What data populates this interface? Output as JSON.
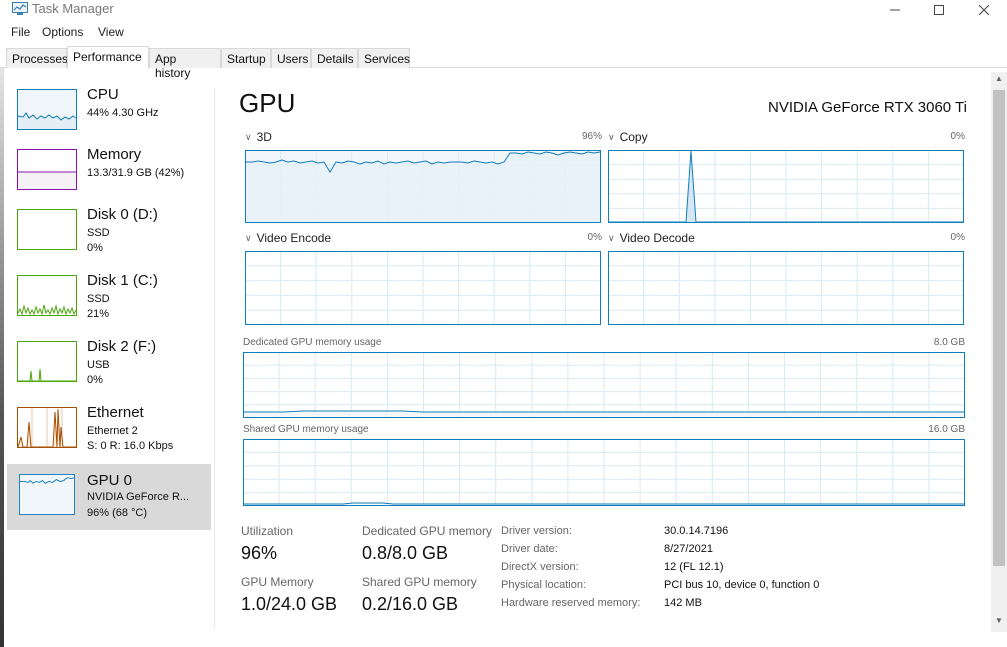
{
  "window": {
    "title": "Task Manager"
  },
  "menu": [
    "File",
    "Options",
    "View"
  ],
  "tabs": [
    {
      "label": "Processes"
    },
    {
      "label": "Performance"
    },
    {
      "label": "App history"
    },
    {
      "label": "Startup"
    },
    {
      "label": "Users"
    },
    {
      "label": "Details"
    },
    {
      "label": "Services"
    }
  ],
  "sidebar": [
    {
      "title": "CPU",
      "lines": [
        "44%  4.30 GHz"
      ],
      "color": "#117dbb",
      "fill": "#f1f6fa"
    },
    {
      "title": "Memory",
      "lines": [
        "13.3/31.9 GB (42%)"
      ],
      "color": "#8b12ae",
      "fill": "#f4f2f4"
    },
    {
      "title": "Disk 0 (D:)",
      "lines": [
        "SSD",
        "0%"
      ],
      "color": "#4da60c",
      "fill": "#ffffff"
    },
    {
      "title": "Disk 1 (C:)",
      "lines": [
        "SSD",
        "21%"
      ],
      "color": "#4da60c",
      "fill": "#ffffff"
    },
    {
      "title": "Disk 2 (F:)",
      "lines": [
        "USB",
        "0%"
      ],
      "color": "#4da60c",
      "fill": "#ffffff"
    },
    {
      "title": "Ethernet",
      "lines": [
        "Ethernet 2",
        "S: 0  R: 16.0 Kbps"
      ],
      "color": "#a74f01",
      "fill": "#ffffff"
    },
    {
      "title": "GPU 0",
      "lines": [
        "NVIDIA GeForce R...",
        "96%  (68 °C)"
      ],
      "color": "#117dbb",
      "fill": "#f1f6fa"
    }
  ],
  "main": {
    "heading": "GPU",
    "model": "NVIDIA GeForce RTX 3060 Ti",
    "engines": [
      {
        "label": "3D",
        "max": "96%"
      },
      {
        "label": "Copy",
        "max": "0%"
      },
      {
        "label": "Video Encode",
        "max": "0%"
      },
      {
        "label": "Video Decode",
        "max": "0%"
      }
    ],
    "dedicated": {
      "label": "Dedicated GPU memory usage",
      "max": "8.0 GB"
    },
    "shared": {
      "label": "Shared GPU memory usage",
      "max": "16.0 GB"
    },
    "stats": {
      "utilization": {
        "label": "Utilization",
        "value": "96%"
      },
      "dedicated_mem": {
        "label": "Dedicated GPU memory",
        "value": "0.8/8.0 GB"
      },
      "gpu_mem": {
        "label": "GPU Memory",
        "value": "1.0/24.0 GB"
      },
      "shared_mem": {
        "label": "Shared GPU memory",
        "value": "0.2/16.0 GB"
      }
    },
    "info": [
      {
        "key": "Driver version:",
        "value": "30.0.14.7196"
      },
      {
        "key": "Driver date:",
        "value": "8/27/2021"
      },
      {
        "key": "DirectX version:",
        "value": "12 (FL 12.1)"
      },
      {
        "key": "Physical location:",
        "value": "PCI bus 10, device 0, function 0"
      },
      {
        "key": "Hardware reserved memory:",
        "value": "142 MB"
      }
    ]
  },
  "colors": {
    "gpu_line": "#117dbb",
    "gpu_fill": "#f1f6fa",
    "grid": "#d9eaf4",
    "border": "#117dbb"
  }
}
